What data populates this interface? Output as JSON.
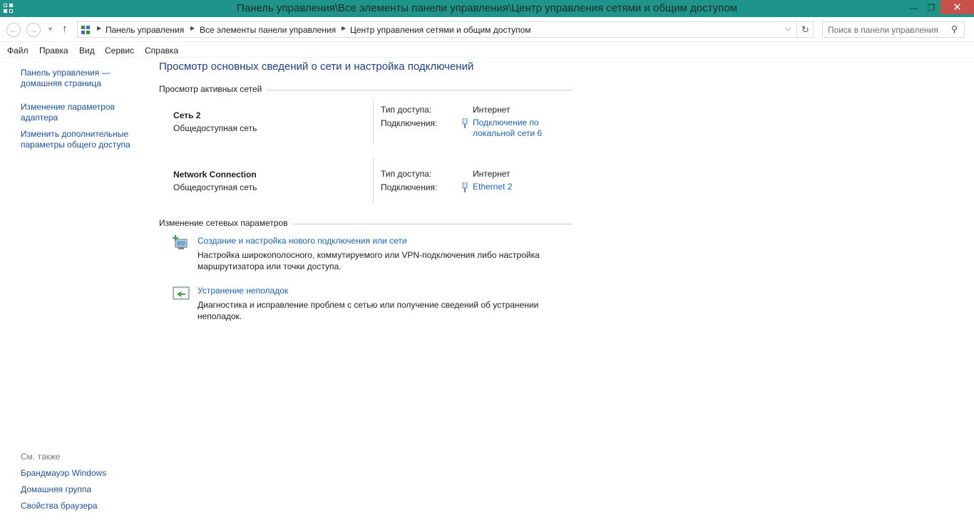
{
  "window": {
    "title": "Панель управления\\Все элементы панели управления\\Центр управления сетями и общим доступом",
    "minimize_glyph": "—",
    "maximize_glyph": "❐",
    "close_glyph": "✕"
  },
  "nav": {
    "back_glyph": "←",
    "forward_glyph": "→",
    "recent_glyph": "▼",
    "up_glyph": "↑",
    "breadcrumbs": [
      "Панель управления",
      "Все элементы панели управления",
      "Центр управления сетями и общим доступом"
    ],
    "crumb_separator": "▶",
    "dropdown_glyph": "⌵",
    "refresh_glyph": "↻",
    "search_placeholder": "Поиск в панели управления",
    "search_glyph": "⚲"
  },
  "menu": [
    "Файл",
    "Правка",
    "Вид",
    "Сервис",
    "Справка"
  ],
  "left": {
    "home_line1": "Панель управления —",
    "home_line2": "домашняя страница",
    "adapter_line1": "Изменение параметров",
    "adapter_line2": "адаптера",
    "sharing_line1": "Изменить дополнительные",
    "sharing_line2": "параметры общего доступа",
    "see_also": "См. также",
    "see_also_items": [
      "Брандмауэр Windows",
      "Домашняя группа",
      "Свойства браузера"
    ]
  },
  "main": {
    "title": "Просмотр основных сведений о сети и настройка подключений",
    "active_networks_title": "Просмотр активных сетей",
    "access_type_label": "Тип доступа:",
    "connections_label": "Подключения:",
    "networks": [
      {
        "name": "Сеть  2",
        "category": "Общедоступная сеть",
        "access_type": "Интернет",
        "connection_line1": "Подключение по",
        "connection_line2": "локальной сети 6"
      },
      {
        "name": "Network Connection",
        "category": "Общедоступная сеть",
        "access_type": "Интернет",
        "connection_line1": "Ethernet 2",
        "connection_line2": ""
      }
    ],
    "change_settings_title": "Изменение сетевых параметров",
    "tasks": [
      {
        "title": "Создание и настройка нового подключения или сети",
        "desc_line1": "Настройка широкополосного, коммутируемого или VPN-подключения либо настройка",
        "desc_line2": "маршрутизатора или точки доступа."
      },
      {
        "title": "Устранение неполадок",
        "desc_line1": "Диагностика и исправление проблем с сетью или получение сведений об устранении",
        "desc_line2": "неполадок."
      }
    ]
  },
  "colors": {
    "titlebar": "#1f948a",
    "close_button": "#c7504a",
    "link": "#1a63b8",
    "heading": "#1a3e8c"
  }
}
